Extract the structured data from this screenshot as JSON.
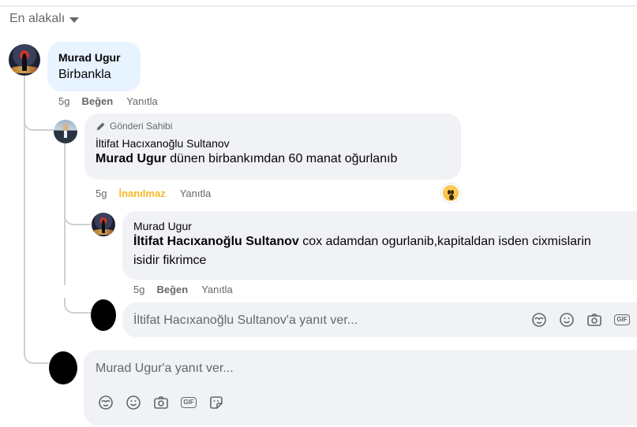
{
  "sort": {
    "label": "En alakalı"
  },
  "comment": {
    "author": "Murad Ugur",
    "text": "Birbankla",
    "time": "5g",
    "like": "Beğen",
    "reply": "Yanıtla"
  },
  "reply1": {
    "badge": "Gönderi Sahibi",
    "author": "İltifat Hacıxanoğlu Sultanov",
    "mention": "Murad Ugur",
    "text": " dünen birbankımdan 60 manat oğurlanıb",
    "time": "5g",
    "reaction": "İnanılmaz",
    "reply": "Yanıtla",
    "reaction_emoji": "wow-emoji"
  },
  "reply2": {
    "author": "Murad Ugur",
    "mention": "İltifat Hacıxanoğlu Sultanov",
    "text": " cox adamdan ogurlanib,kapitaldan isden cixmislarin isidir fikrimce",
    "time": "5g",
    "like": "Beğen",
    "reply": "Yanıtla"
  },
  "reply_input_inner": {
    "placeholder": "İltifat Hacıxanoğlu Sultanov'a yanıt ver..."
  },
  "reply_input_outer": {
    "placeholder": "Murad Ugur'a yanıt ver..."
  },
  "icons": [
    "avatar-sticker-icon",
    "emoji-icon",
    "camera-icon",
    "gif-icon",
    "sticker-icon"
  ],
  "gif_label": "GIF",
  "colors": {
    "reaction_wow": "#f7b928",
    "bubble": "#f0f2f5",
    "bubble_highlight": "#e7f3ff",
    "muted_text": "#65676b"
  }
}
